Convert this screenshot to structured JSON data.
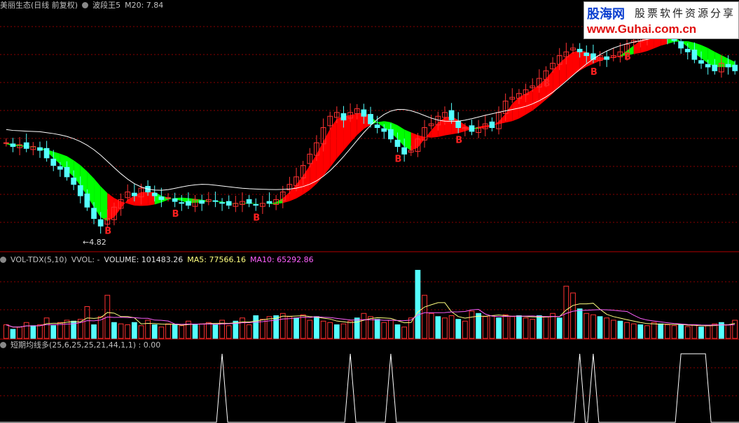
{
  "header_main": {
    "title": "美丽生态(日线 前复权)",
    "indicator": "波段王5",
    "ma20": "M20: 7.84"
  },
  "header_vol": {
    "name": "VOL-TDX(5,10)",
    "vvol": "VVOL: -",
    "volume": "VOLUME: 101483.26",
    "ma5": "MA5: 77566.16",
    "ma10": "MA10: 65292.86"
  },
  "header_sig": {
    "name": "短期均线多(25,6,25,25,21,44,1,1) : 0.00"
  },
  "logo": {
    "cn": "股海网",
    "slogan": "股票软件资源分享",
    "url": "www.Guhai.com.cn"
  },
  "low_label": "4.82",
  "buy_label": "B",
  "colors": {
    "up": "#ff3232",
    "down": "#54ffff",
    "ribbon_up": "#ff0000",
    "ribbon_down": "#00ff00",
    "ma_line": "#ffffff",
    "grid": "#8b0000",
    "ma5": "#ffff80",
    "ma10": "#ff60ff"
  },
  "chart_data": [
    {
      "type": "candlestick",
      "title": "波段王5",
      "ylim": [
        4.5,
        10.5
      ],
      "close": [
        7.1,
        7.0,
        7.05,
        6.95,
        7.0,
        6.9,
        6.7,
        6.5,
        6.4,
        6.2,
        6.0,
        5.7,
        5.4,
        5.1,
        4.9,
        5.1,
        5.4,
        5.6,
        5.8,
        5.7,
        5.9,
        5.8,
        5.7,
        5.6,
        5.65,
        5.55,
        5.5,
        5.45,
        5.6,
        5.5,
        5.6,
        5.55,
        5.5,
        5.45,
        5.5,
        5.55,
        5.5,
        5.45,
        5.5,
        5.5,
        5.6,
        5.8,
        6.0,
        6.2,
        6.5,
        6.8,
        7.1,
        7.5,
        7.8,
        7.9,
        7.7,
        7.9,
        8.0,
        7.8,
        7.6,
        7.5,
        7.4,
        7.2,
        7.0,
        6.8,
        6.9,
        7.2,
        7.5,
        7.6,
        7.8,
        7.9,
        7.7,
        7.5,
        7.5,
        7.4,
        7.5,
        7.6,
        7.5,
        7.9,
        8.2,
        8.3,
        8.4,
        8.5,
        8.6,
        8.8,
        9.0,
        9.2,
        9.4,
        9.5,
        9.6,
        9.5,
        9.4,
        9.3,
        9.4,
        9.3,
        9.4,
        9.5,
        9.7,
        9.8,
        9.9,
        10.0,
        10.1,
        10.0,
        9.9,
        9.8,
        9.6,
        9.5,
        9.3,
        9.2,
        9.1,
        9.0,
        9.2,
        9.1,
        9.0
      ],
      "ribbon_up_ranges": [
        [
          15,
          21
        ],
        [
          41,
          53
        ],
        [
          60,
          68
        ],
        [
          70,
          90
        ],
        [
          93,
          97
        ]
      ],
      "buy_signal_index": [
        15,
        25,
        37,
        58,
        67,
        80,
        87,
        92
      ]
    },
    {
      "type": "bar",
      "title": "VOL-TDX(5,10)",
      "volume": 101483.26,
      "ma5": 77566.16,
      "ma10": 65292.86,
      "values": [
        30,
        20,
        25,
        35,
        28,
        30,
        45,
        28,
        35,
        40,
        38,
        42,
        70,
        30,
        48,
        95,
        35,
        32,
        30,
        35,
        28,
        40,
        30,
        25,
        32,
        30,
        28,
        38,
        30,
        32,
        35,
        30,
        40,
        28,
        38,
        45,
        30,
        50,
        42,
        48,
        50,
        55,
        48,
        45,
        52,
        40,
        48,
        38,
        35,
        30,
        32,
        38,
        45,
        55,
        48,
        42,
        35,
        40,
        30,
        25,
        45,
        150,
        95,
        55,
        48,
        45,
        50,
        42,
        38,
        60,
        55,
        48,
        50,
        45,
        52,
        48,
        50,
        45,
        42,
        50,
        48,
        55,
        45,
        115,
        100,
        65,
        55,
        52,
        48,
        45,
        40,
        38,
        35,
        32,
        30,
        28,
        35,
        32,
        30,
        28,
        30,
        26,
        30,
        25,
        28,
        32,
        35,
        30,
        40
      ]
    },
    {
      "type": "line",
      "title": "短期均线多",
      "value": 0.0,
      "signal_index": [
        32,
        51,
        57,
        85,
        87,
        100
      ]
    }
  ]
}
